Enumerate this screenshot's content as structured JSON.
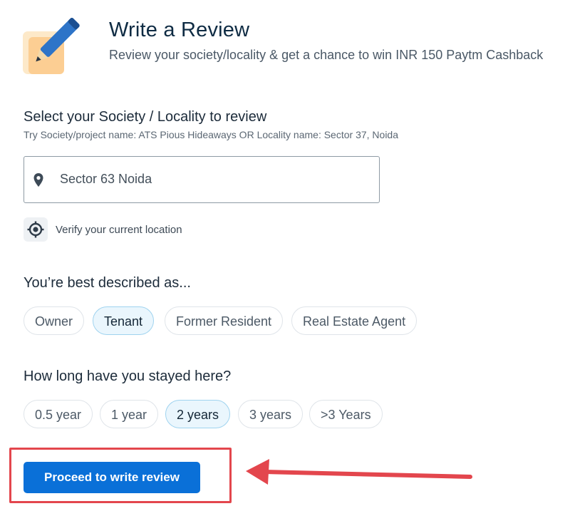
{
  "header": {
    "title": "Write a Review",
    "subtitle": "Review your society/locality & get a chance to win INR 150 Paytm Cashback",
    "icon": "pencil-note-icon"
  },
  "society": {
    "heading": "Select your Society / Locality to review",
    "hint": "Try Society/project name: ATS Pious Hideaways OR Locality name: Sector 37, Noida",
    "value": "Sector 63 Noida",
    "location_icon": "map-pin-icon",
    "verify_label": "Verify your current location",
    "verify_icon": "crosshair-location-icon"
  },
  "described": {
    "heading": "You’re best described as...",
    "options": [
      "Owner",
      "Tenant",
      "Former Resident",
      "Real Estate Agent"
    ],
    "selected": "Tenant"
  },
  "stay": {
    "heading": "How long have you stayed here?",
    "options": [
      "0.5 year",
      "1 year",
      "2 years",
      "3 years",
      ">3 Years"
    ],
    "selected": "2 years"
  },
  "proceed": {
    "label": "Proceed to write review"
  },
  "colors": {
    "primary": "#0a70d8",
    "chip_active_bg": "#eaf6fd",
    "chip_active_border": "#9fd3ef",
    "annotation": "#e3464d"
  }
}
